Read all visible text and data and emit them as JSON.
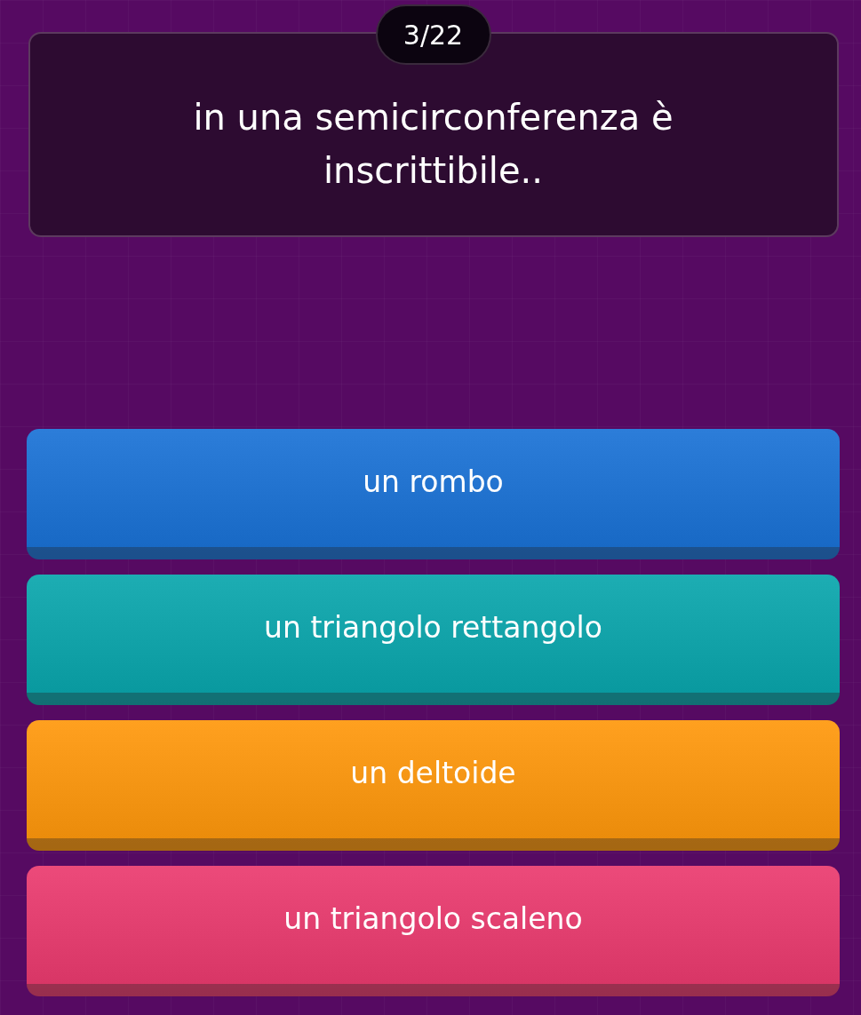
{
  "counter": "3/22",
  "question": "in una semicirconferenza è inscrittibile..",
  "answers": [
    {
      "label": "un rombo",
      "color": "#1a72d6"
    },
    {
      "label": "un triangolo rettangolo",
      "color": "#0aa6ad"
    },
    {
      "label": "un deltoide",
      "color": "#ff980c"
    },
    {
      "label": "un triangolo scaleno",
      "color": "#ea3b6f"
    }
  ]
}
